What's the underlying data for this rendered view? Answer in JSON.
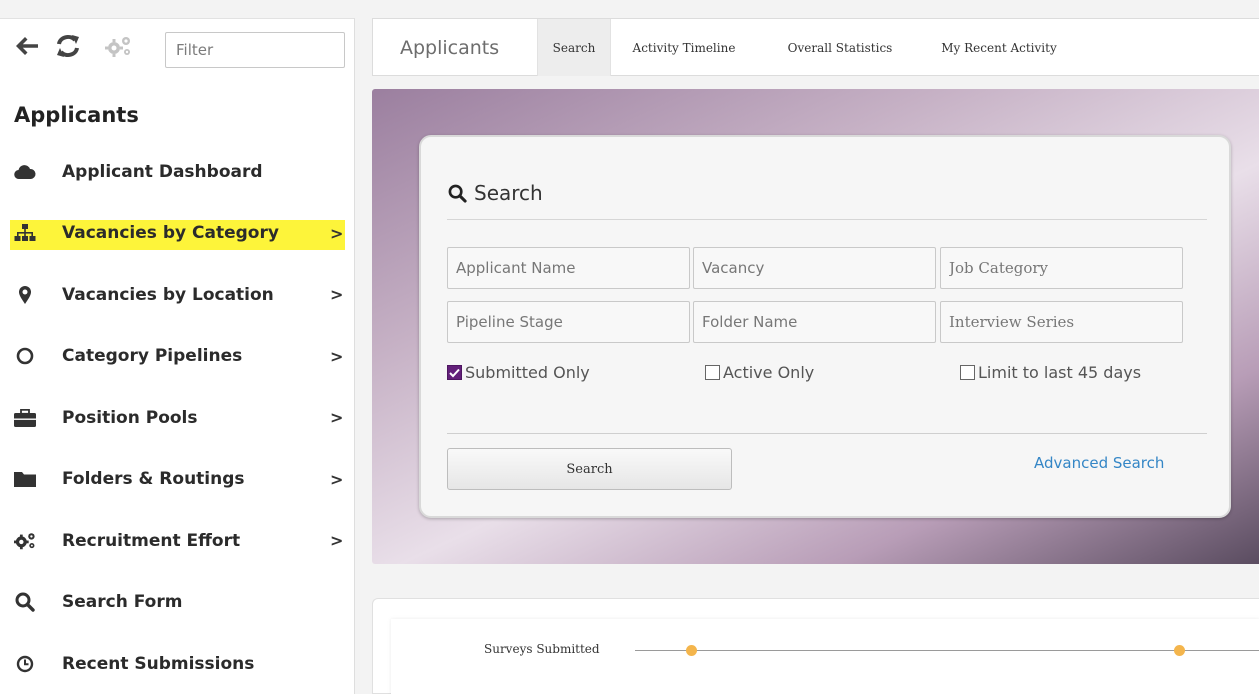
{
  "toolbar": {
    "back_icon": "arrow-left-icon",
    "refresh_icon": "refresh-icon",
    "settings_icon": "gears-icon",
    "filter_placeholder": "Filter"
  },
  "sidebar": {
    "heading": "Applicants",
    "items": [
      {
        "label": "Applicant Dashboard",
        "icon": "cloud-icon",
        "chevron": ""
      },
      {
        "label": "Vacancies by Category",
        "icon": "sitemap-icon",
        "chevron": ">",
        "highlight": "#fdf43a"
      },
      {
        "label": "Vacancies by Location",
        "icon": "map-marker-icon",
        "chevron": ">"
      },
      {
        "label": "Category Pipelines",
        "icon": "circle-icon",
        "chevron": ">"
      },
      {
        "label": "Position Pools",
        "icon": "briefcase-icon",
        "chevron": ">"
      },
      {
        "label": "Folders & Routings",
        "icon": "folder-icon",
        "chevron": ">"
      },
      {
        "label": "Recruitment Effort",
        "icon": "gears-icon",
        "chevron": ">"
      },
      {
        "label": "Search Form",
        "icon": "search-icon",
        "chevron": ""
      },
      {
        "label": "Recent Submissions",
        "icon": "clock-icon",
        "chevron": ""
      }
    ]
  },
  "topbar": {
    "brand": "Applicants",
    "tabs": [
      {
        "label": "Search",
        "active": true
      },
      {
        "label": "Activity Timeline"
      },
      {
        "label": "Overall Statistics"
      },
      {
        "label": "My Recent Activity"
      }
    ]
  },
  "search": {
    "title": "Search",
    "fields": {
      "applicant_name": "Applicant Name",
      "vacancy": "Vacancy",
      "job_category": "Job Category",
      "pipeline_stage": "Pipeline Stage",
      "folder_name": "Folder Name",
      "interview_series": "Interview Series"
    },
    "checks": {
      "submitted_only": {
        "label": "Submitted Only",
        "checked": true
      },
      "active_only": {
        "label": "Active Only",
        "checked": false
      },
      "limit_45": {
        "label": "Limit to last 45 days",
        "checked": false
      }
    },
    "button": "Search",
    "advanced_link": "Advanced Search"
  },
  "timeline": {
    "label": "Surveys Submitted"
  },
  "colors": {
    "highlight": "#fdf43a",
    "checkbox": "#63207a",
    "link": "#3486c6",
    "dot": "#f4b54c"
  }
}
